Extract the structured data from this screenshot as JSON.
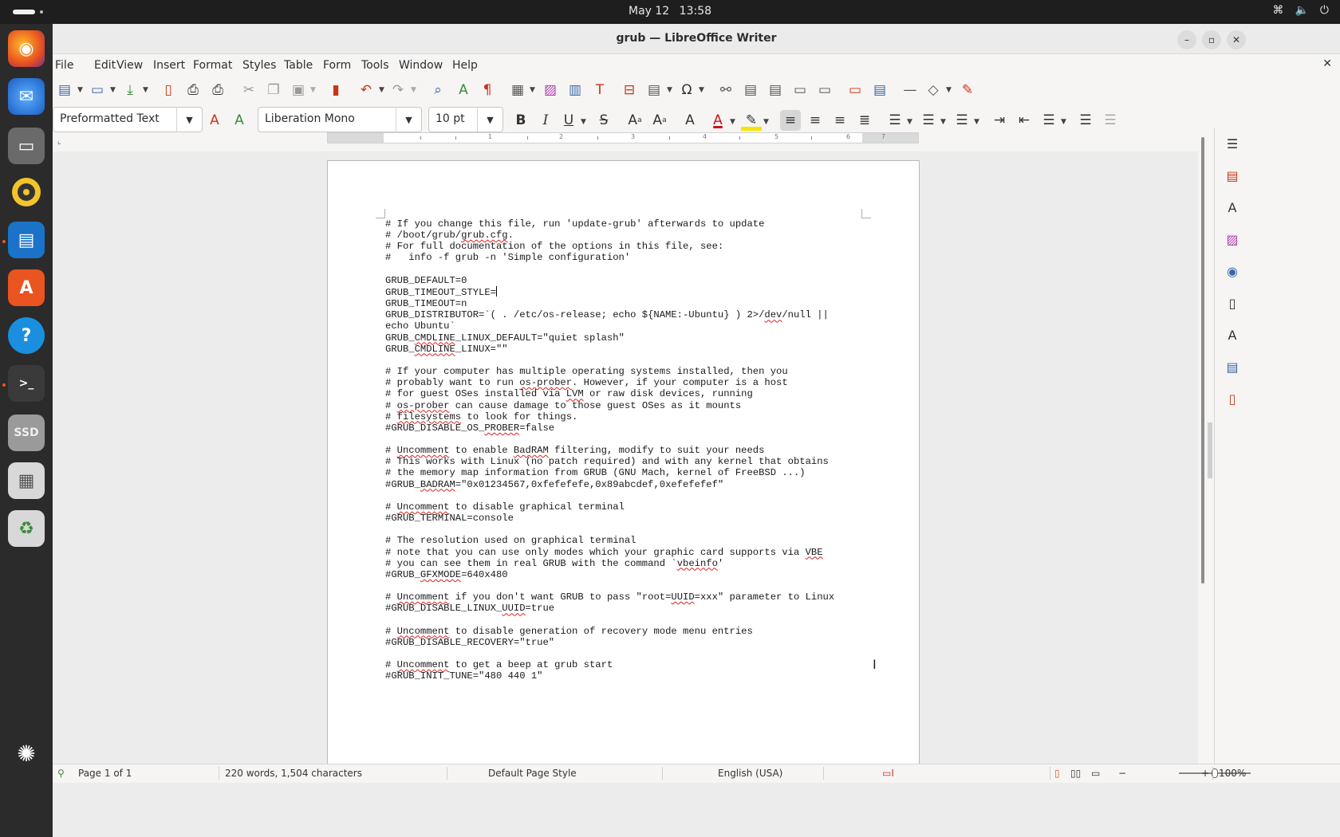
{
  "system": {
    "date": "May 12",
    "time": "13:58"
  },
  "window": {
    "title": "grub — LibreOffice Writer"
  },
  "menu": [
    "File",
    "Edit",
    "View",
    "Insert",
    "Format",
    "Styles",
    "Table",
    "Form",
    "Tools",
    "Window",
    "Help"
  ],
  "formatting": {
    "paragraph_style": "Preformatted Text",
    "font_name": "Liberation Mono",
    "font_size": "10 pt"
  },
  "document": {
    "lines": [
      [
        {
          "t": "# If you change this file, run 'update-grub' afterwards to update"
        }
      ],
      [
        {
          "t": "# /boot/grub/"
        },
        {
          "t": "grub.cfg",
          "s": true
        },
        {
          "t": "."
        }
      ],
      [
        {
          "t": "# For full documentation of the options in this file, see:"
        }
      ],
      [
        {
          "t": "#   info -f grub -n 'Simple configuration'"
        }
      ],
      [
        {
          "t": ""
        }
      ],
      [
        {
          "t": "GRUB_DEFAULT=0"
        }
      ],
      [
        {
          "t": "GRUB_TIMEOUT_STYLE="
        },
        {
          "caret": true
        }
      ],
      [
        {
          "t": "GRUB_TIMEOUT=n"
        }
      ],
      [
        {
          "t": "GRUB_DISTRIBUTOR=`( . /etc/os-release; echo ${NAME:-Ubuntu} ) 2>/"
        },
        {
          "t": "dev",
          "s": true
        },
        {
          "t": "/null ||"
        }
      ],
      [
        {
          "t": "echo Ubuntu`"
        }
      ],
      [
        {
          "t": "GRUB_"
        },
        {
          "t": "CMDLINE",
          "s": true
        },
        {
          "t": "_LINUX_DEFAULT=\"quiet splash\""
        }
      ],
      [
        {
          "t": "GRUB_"
        },
        {
          "t": "CMDLINE",
          "s": true
        },
        {
          "t": "_LINUX=\"\""
        }
      ],
      [
        {
          "t": ""
        }
      ],
      [
        {
          "t": "# If your computer has multiple operating systems installed, then you"
        }
      ],
      [
        {
          "t": "# probably want to run "
        },
        {
          "t": "os-prober",
          "s": true
        },
        {
          "t": ". However, if your computer is a host"
        }
      ],
      [
        {
          "t": "# for guest OSes installed via "
        },
        {
          "t": "LVM",
          "s": true
        },
        {
          "t": " or raw disk devices, running"
        }
      ],
      [
        {
          "t": "# "
        },
        {
          "t": "os-prober",
          "s": true
        },
        {
          "t": " can cause damage to those guest OSes as it mounts"
        }
      ],
      [
        {
          "t": "# "
        },
        {
          "t": "filesystems",
          "s": true
        },
        {
          "t": " to look for things."
        }
      ],
      [
        {
          "t": "#GRUB_DISABLE_OS_"
        },
        {
          "t": "PROBER",
          "s": true
        },
        {
          "t": "=false"
        }
      ],
      [
        {
          "t": ""
        }
      ],
      [
        {
          "t": "# "
        },
        {
          "t": "Uncomment",
          "s": true
        },
        {
          "t": " to enable "
        },
        {
          "t": "BadRAM",
          "s": true
        },
        {
          "t": " filtering, modify to suit your needs"
        }
      ],
      [
        {
          "t": "# This works with Linux (no patch required) and with any kernel that obtains"
        }
      ],
      [
        {
          "t": "# the memory map information from GRUB (GNU Mach, kernel of FreeBSD ...)"
        }
      ],
      [
        {
          "t": "#GRUB_"
        },
        {
          "t": "BADRAM",
          "s": true
        },
        {
          "t": "=\"0x01234567,0xfefefefe,0x89abcdef,0xefefefef\""
        }
      ],
      [
        {
          "t": ""
        }
      ],
      [
        {
          "t": "# "
        },
        {
          "t": "Uncomment",
          "s": true
        },
        {
          "t": " to disable graphical terminal"
        }
      ],
      [
        {
          "t": "#GRUB_TERMINAL=console"
        }
      ],
      [
        {
          "t": ""
        }
      ],
      [
        {
          "t": "# The resolution used on graphical terminal"
        }
      ],
      [
        {
          "t": "# note that you can use only modes which your graphic card supports via "
        },
        {
          "t": "VBE",
          "s": true
        }
      ],
      [
        {
          "t": "# you can see them in real GRUB with the command `"
        },
        {
          "t": "vbeinfo",
          "s": true
        },
        {
          "t": "'"
        }
      ],
      [
        {
          "t": "#GRUB_"
        },
        {
          "t": "GFXMODE",
          "s": true
        },
        {
          "t": "=640x480"
        }
      ],
      [
        {
          "t": ""
        }
      ],
      [
        {
          "t": "# "
        },
        {
          "t": "Uncomment",
          "s": true
        },
        {
          "t": " if you don't want GRUB to pass \"root="
        },
        {
          "t": "UUID",
          "s": true
        },
        {
          "t": "=xxx\" parameter to Linux"
        }
      ],
      [
        {
          "t": "#GRUB_DISABLE_LINUX_"
        },
        {
          "t": "UUID",
          "s": true
        },
        {
          "t": "=true"
        }
      ],
      [
        {
          "t": ""
        }
      ],
      [
        {
          "t": "# "
        },
        {
          "t": "Uncomment",
          "s": true
        },
        {
          "t": " to disable generation of recovery mode menu entries"
        }
      ],
      [
        {
          "t": "#GRUB_DISABLE_RECOVERY=\"true\""
        }
      ],
      [
        {
          "t": ""
        }
      ],
      [
        {
          "t": "# "
        },
        {
          "t": "Uncomment",
          "s": true
        },
        {
          "t": " to get a beep at grub start"
        }
      ],
      [
        {
          "t": "#GRUB_INIT_TUNE=\"480 440 1\""
        }
      ]
    ]
  },
  "status": {
    "page": "Page 1 of 1",
    "word_count": "220 words, 1,504 characters",
    "page_style": "Default Page Style",
    "language": "English (USA)",
    "zoom": "100%"
  },
  "dock": {
    "ssd_label": "SSD"
  },
  "colors": {
    "accent_orange": "#e95420",
    "spell_error": "#e02020",
    "toolbar_blue": "#3a66a7"
  }
}
